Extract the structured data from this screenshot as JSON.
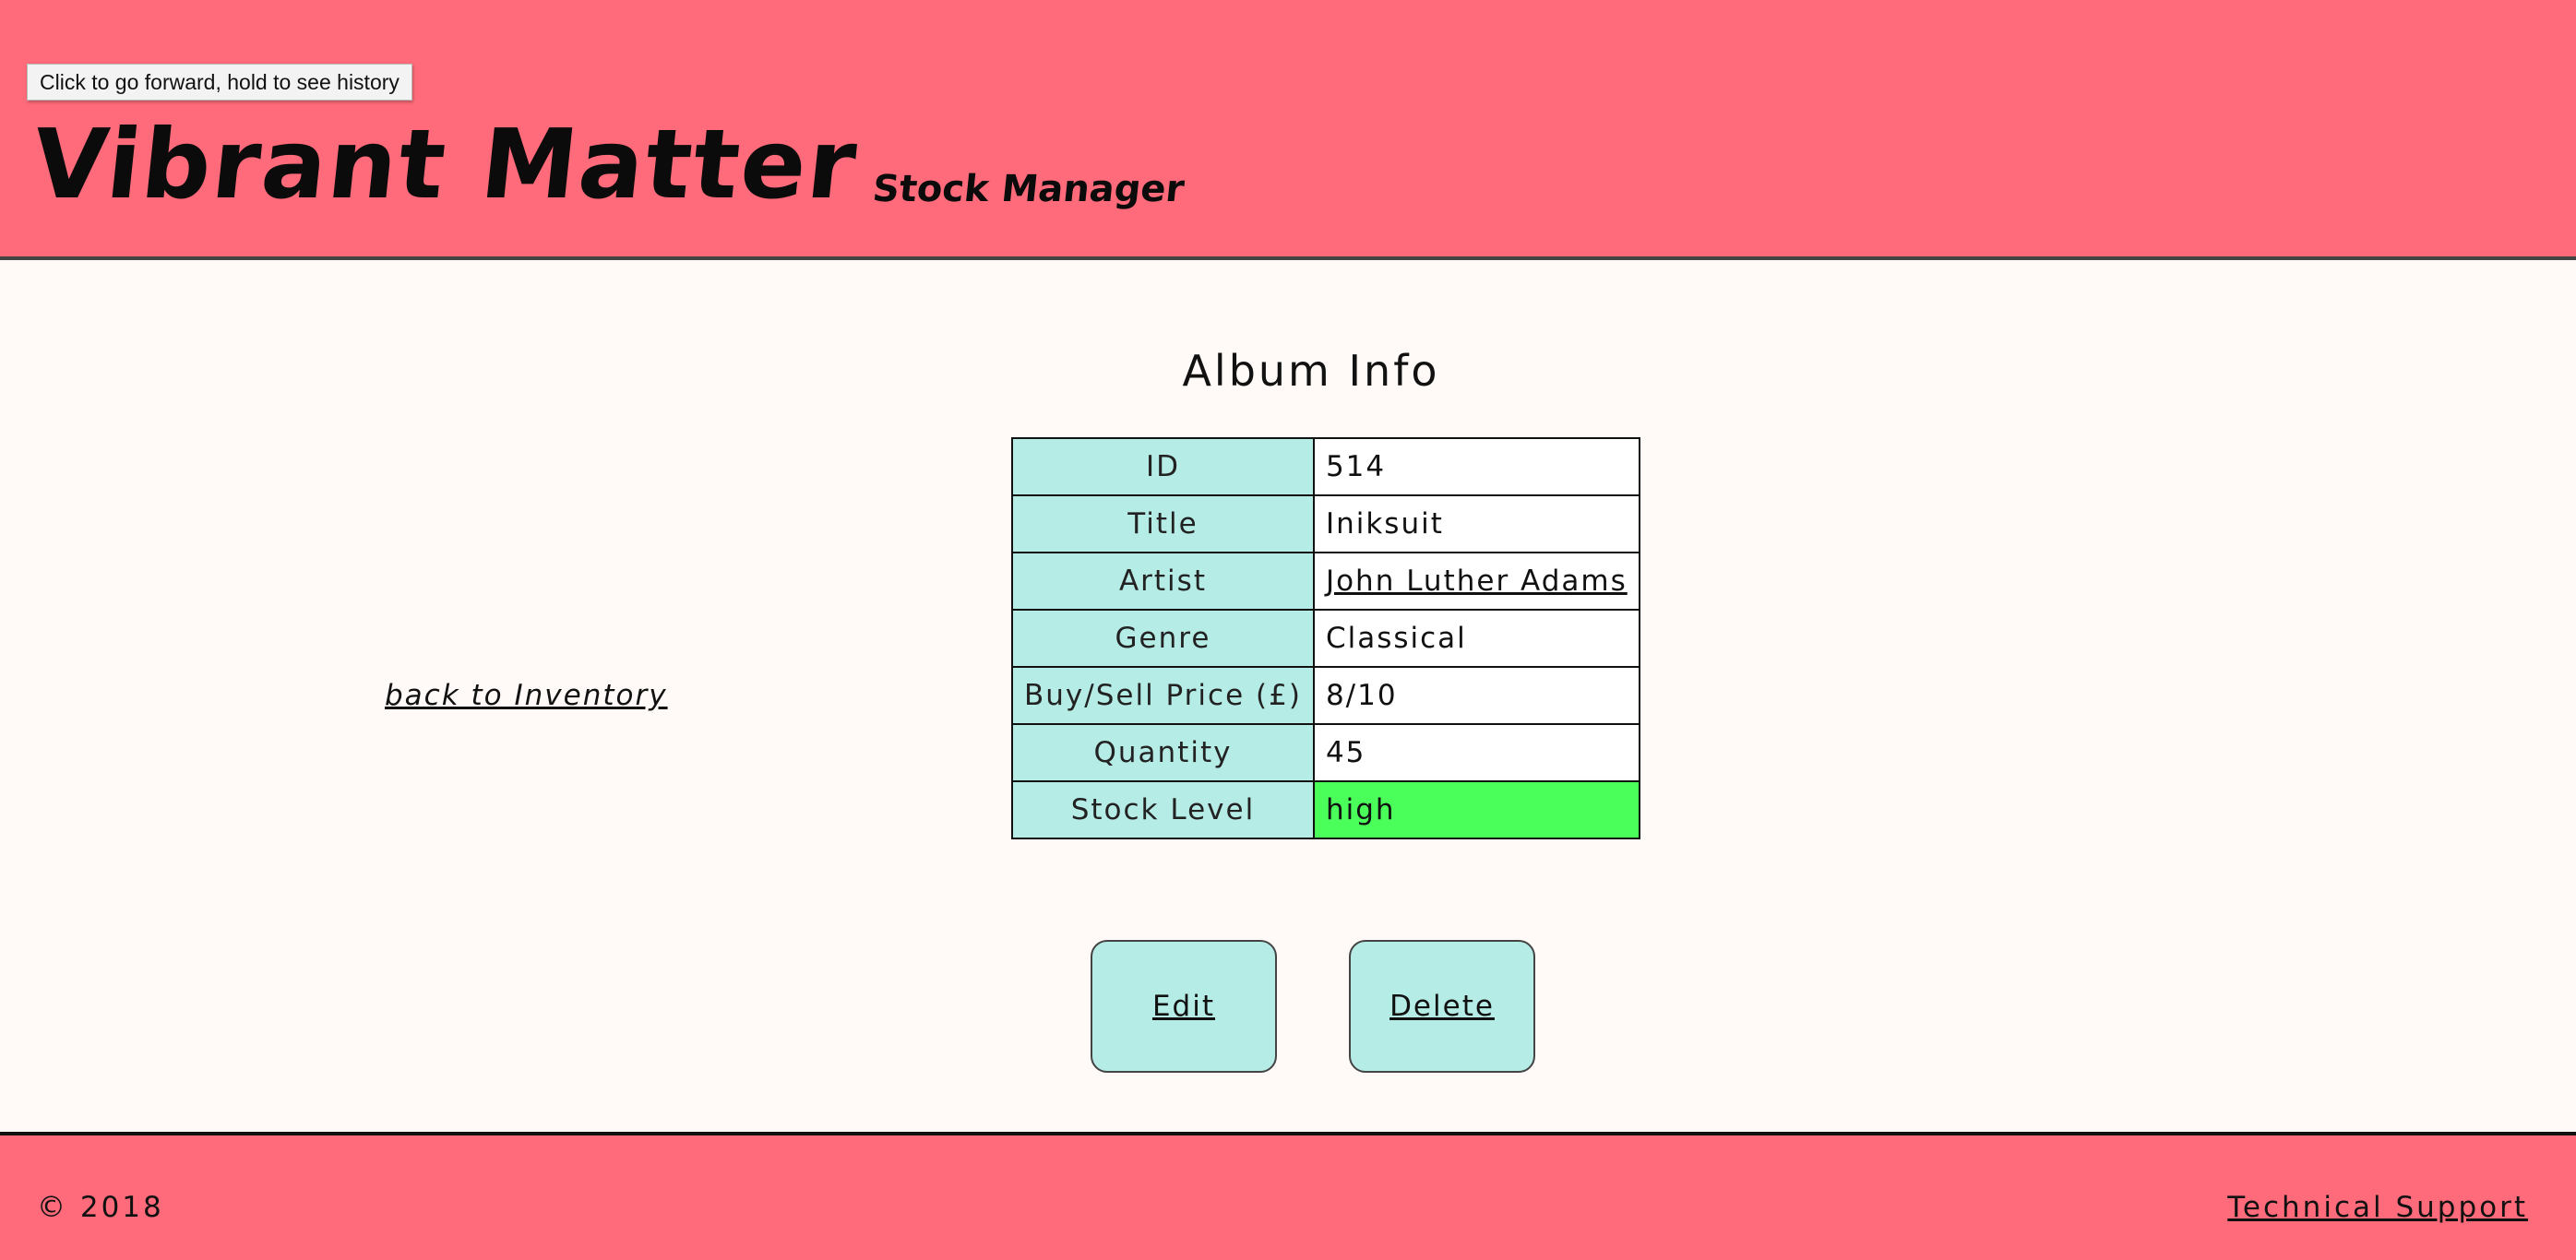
{
  "browser": {
    "tooltip": "Click to go forward, hold to see history"
  },
  "header": {
    "site_title": "Vibrant Matter",
    "subtitle": "Stock Manager"
  },
  "nav": {
    "back_link": "back to Inventory"
  },
  "main": {
    "heading": "Album Info",
    "rows": [
      {
        "label": "ID",
        "value": "514"
      },
      {
        "label": "Title",
        "value": "Iniksuit"
      },
      {
        "label": "Artist",
        "value": "John Luther Adams"
      },
      {
        "label": "Genre",
        "value": "Classical"
      },
      {
        "label": "Buy/Sell Price (£)",
        "value": "8/10"
      },
      {
        "label": "Quantity",
        "value": "45"
      },
      {
        "label": "Stock Level",
        "value": "high"
      }
    ],
    "actions": {
      "edit_label": "Edit",
      "delete_label": "Delete"
    }
  },
  "footer": {
    "copyright": "© 2018",
    "support_link": "Technical Support"
  },
  "colors": {
    "header_bg": "#ff6b7a",
    "page_bg": "#fffaf7",
    "label_cell_bg": "#b5ece6",
    "stock_high_bg": "#4bff5a"
  }
}
